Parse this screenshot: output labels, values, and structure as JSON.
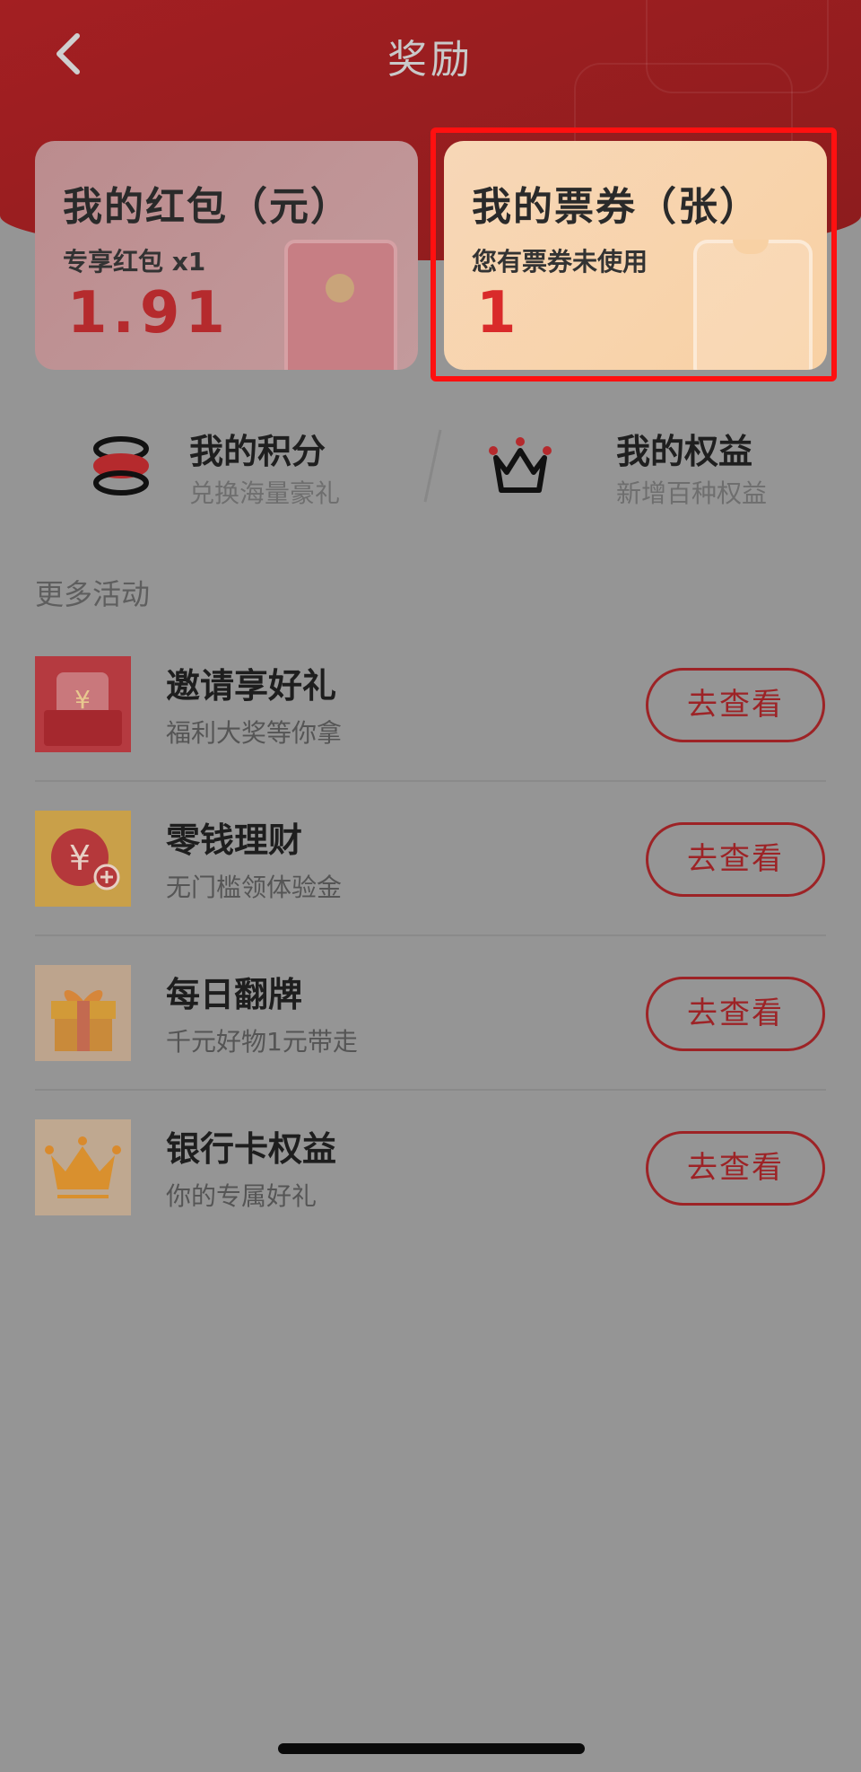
{
  "header": {
    "title": "奖励",
    "bg_color": "#961f21"
  },
  "cards": {
    "red_packet": {
      "title": "我的红包（元）",
      "subtitle": "专享红包 x1",
      "value": "1.91"
    },
    "tickets": {
      "title": "我的票券（张）",
      "subtitle": "您有票券未使用",
      "value": "1",
      "highlight_color": "#ff1010"
    }
  },
  "shortcuts": [
    {
      "title": "我的积分",
      "subtitle": "兑换海量豪礼",
      "icon": "coin-stack-icon"
    },
    {
      "title": "我的权益",
      "subtitle": "新增百种权益",
      "icon": "crown-icon"
    }
  ],
  "activities": {
    "section_title": "更多活动",
    "items": [
      {
        "title": "邀请享好礼",
        "subtitle": "福利大奖等你拿",
        "button": "去查看",
        "icon": "red-envelope-icon"
      },
      {
        "title": "零钱理财",
        "subtitle": "无门槛领体验金",
        "button": "去查看",
        "icon": "yuan-coin-icon"
      },
      {
        "title": "每日翻牌",
        "subtitle": "千元好物1元带走",
        "button": "去查看",
        "icon": "gift-box-icon"
      },
      {
        "title": "银行卡权益",
        "subtitle": "你的专属好礼",
        "button": "去查看",
        "icon": "crown-icon"
      }
    ]
  },
  "colors": {
    "accent": "#9d2326",
    "overlay_bg": "#959595"
  }
}
